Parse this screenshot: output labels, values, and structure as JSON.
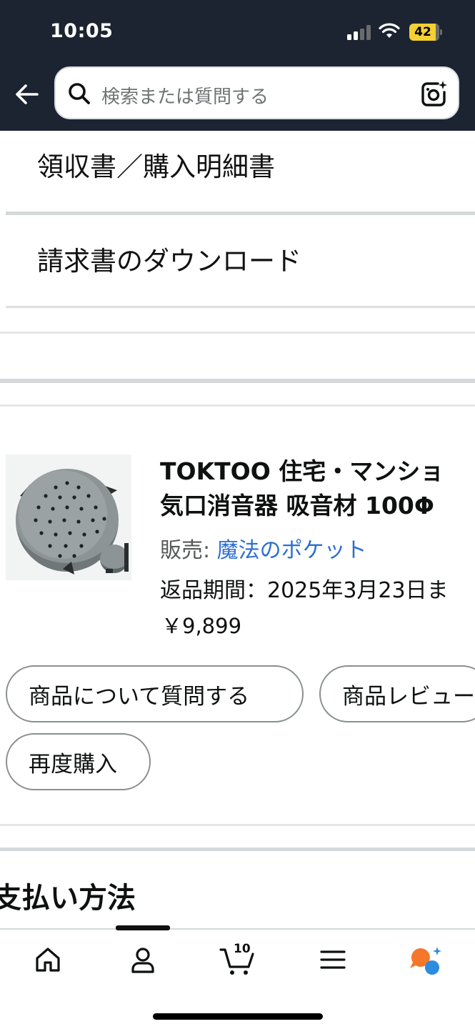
{
  "status_bar": {
    "time": "10:05",
    "battery": "42"
  },
  "search": {
    "placeholder": "検索または質問する"
  },
  "menu": {
    "receipt": "領収書／購入明細書",
    "invoice_download": "請求書のダウンロード"
  },
  "product": {
    "title_line1": "TOKTOO 住宅・マンショ",
    "title_line2": "気口消音器 吸音材 100Φ",
    "seller_label": "販売: ",
    "seller_name": "魔法のポケット",
    "return_period": "返品期間：2025年3月23日ま",
    "price": "￥9,899"
  },
  "actions": {
    "ask_question": "商品について質問する",
    "review": "商品レビュー",
    "buy_again": "再度購入"
  },
  "section": {
    "payment_heading": "支払い方法"
  },
  "bottom_nav": {
    "cart_count": "10",
    "items": [
      "home-icon",
      "account-icon",
      "cart-icon",
      "menu-icon",
      "rufus-icon"
    ]
  },
  "colors": {
    "header_bg": "#1b2430",
    "link": "#2d6ed0",
    "battery": "#f5d033",
    "rufus_orange": "#f5772a",
    "rufus_blue": "#2b8ce0"
  }
}
